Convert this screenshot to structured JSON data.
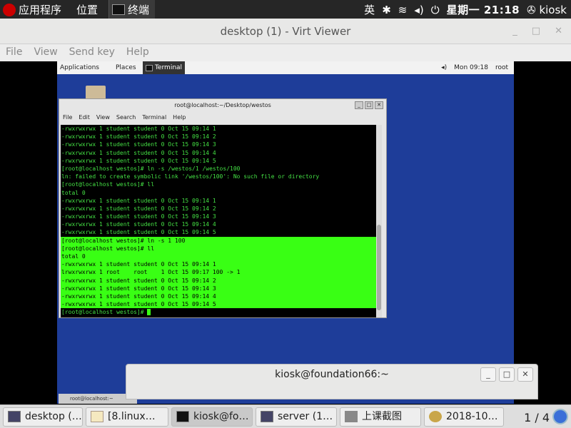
{
  "host_panel": {
    "applications": "应用程序",
    "places": "位置",
    "active_task": "终端",
    "input_method": "英",
    "clock": "星期一 21:18",
    "user": "kiosk"
  },
  "virt_viewer": {
    "title": "desktop (1) - Virt Viewer",
    "menu": [
      "File",
      "View",
      "Send key",
      "Help"
    ]
  },
  "guest_panel": {
    "applications": "Applications",
    "places": "Places",
    "task": "Terminal",
    "clock": "Mon 09:18",
    "user": "root"
  },
  "terminal": {
    "title": "root@localhost:~/Desktop/westos",
    "menu": [
      "File",
      "Edit",
      "View",
      "Search",
      "Terminal",
      "Help"
    ],
    "lines": [
      "-rwxrwxrwx 1 student student 0 Oct 15 09:14 1",
      "-rwxrwxrwx 1 student student 0 Oct 15 09:14 2",
      "-rwxrwxrwx 1 student student 0 Oct 15 09:14 3",
      "-rwxrwxrwx 1 student student 0 Oct 15 09:14 4",
      "-rwxrwxrwx 1 student student 0 Oct 15 09:14 5",
      "[root@localhost westos]# ln -s /westos/1 /westos/100",
      "ln: failed to create symbolic link '/westos/100': No such file or directory",
      "[root@localhost westos]# ll",
      "total 0",
      "-rwxrwxrwx 1 student student 0 Oct 15 09:14 1",
      "-rwxrwxrwx 1 student student 0 Oct 15 09:14 2",
      "-rwxrwxrwx 1 student student 0 Oct 15 09:14 3",
      "-rwxrwxrwx 1 student student 0 Oct 15 09:14 4",
      "-rwxrwxrwx 1 student student 0 Oct 15 09:14 5"
    ],
    "highlighted_lines": [
      "[root@localhost westos]# ln -s 1 100",
      "[root@localhost westos]# ll",
      "total 0",
      "-rwxrwxrwx 1 student student 0 Oct 15 09:14 1",
      "lrwxrwxrwx 1 root    root    1 Oct 15 09:17 100 -> 1",
      "-rwxrwxrwx 1 student student 0 Oct 15 09:14 2",
      "-rwxrwxrwx 1 student student 0 Oct 15 09:14 3",
      "-rwxrwxrwx 1 student student 0 Oct 15 09:14 4",
      "-rwxrwxrwx 1 student student 0 Oct 15 09:14 5",
      "[root@localhost westos]# "
    ],
    "guest_task": "root@localhost:~"
  },
  "foreground_window": {
    "title": "kiosk@foundation66:~"
  },
  "taskbar": {
    "items": [
      "desktop (…",
      "[8.linux…",
      "kiosk@fo…",
      "server (1…",
      "上课截图",
      "2018-10…"
    ],
    "pager": "1 / 4"
  }
}
